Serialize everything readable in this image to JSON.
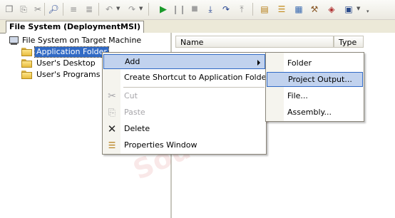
{
  "toolbar": {
    "buttons": [
      "copy-icon",
      "paste-icon",
      "find-icon",
      "indent-icon",
      "outdent-icon",
      "undo-icon",
      "redo-icon",
      "start-icon",
      "pause-icon",
      "stop-icon",
      "step-into-icon",
      "step-over-icon",
      "step-out-icon",
      "solution-explorer-icon",
      "properties-icon",
      "object-browser-icon",
      "toolbox-icon",
      "class-view-icon",
      "command-window-icon"
    ]
  },
  "document_tab": {
    "label": "File System (DeploymentMSI)"
  },
  "tree": {
    "root": "File System on Target Machine",
    "items": [
      {
        "label": "Application Folder",
        "selected": true
      },
      {
        "label": "User's Desktop"
      },
      {
        "label": "User's Programs Menu"
      }
    ]
  },
  "list": {
    "columns": [
      "Name",
      "Type"
    ]
  },
  "watermark": {
    "text": "SourceCode"
  },
  "context_menu": {
    "items": [
      {
        "label": "Add",
        "icon": "",
        "has_submenu": true,
        "highlighted": true
      },
      {
        "label": "Create Shortcut to Application Folder"
      },
      {
        "label": "Cut",
        "icon": "scissors-icon",
        "disabled": true
      },
      {
        "label": "Paste",
        "icon": "paste-icon",
        "disabled": true
      },
      {
        "label": "Delete",
        "icon": "delete-x-icon"
      },
      {
        "label": "Properties Window",
        "icon": "properties-icon"
      }
    ]
  },
  "add_submenu": {
    "items": [
      {
        "label": "Folder"
      },
      {
        "label": "Project Output...",
        "highlighted": true
      },
      {
        "label": "File..."
      },
      {
        "label": "Assembly..."
      }
    ]
  }
}
